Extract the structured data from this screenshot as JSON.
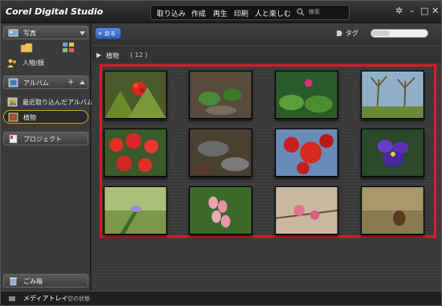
{
  "app": {
    "title": "Corel Digital Studio"
  },
  "menubar": {
    "items": [
      "取り込み",
      "作成",
      "再生",
      "印刷",
      "人と楽しむ"
    ],
    "search_placeholder": "検索"
  },
  "window_controls": {
    "settings": "✲",
    "minimize": "–",
    "maximize": "□",
    "close": "✕"
  },
  "sidebar": {
    "photos_label": "写真",
    "people_label": "人物/顔",
    "albums_label": "アルバム",
    "recent_albums_label": "最近取り込んだアルバム",
    "selected_album_label": "植物",
    "project_label": "プロジェクト",
    "trash_label": "ごみ箱"
  },
  "toolbar": {
    "back_label": "戻る",
    "tag_label": "タグ"
  },
  "breadcrumb": {
    "label": "植物",
    "count": "( 12 )"
  },
  "thumbnails": [
    {
      "name": "thumb-red-flower-buds"
    },
    {
      "name": "thumb-green-shoots"
    },
    {
      "name": "thumb-pink-flower-leaves"
    },
    {
      "name": "thumb-bare-trees"
    },
    {
      "name": "thumb-red-dahlias"
    },
    {
      "name": "thumb-garden-stones"
    },
    {
      "name": "thumb-red-berries-tree"
    },
    {
      "name": "thumb-purple-pansy"
    },
    {
      "name": "thumb-crocus-bud"
    },
    {
      "name": "thumb-pink-bell-flowers"
    },
    {
      "name": "thumb-pink-buds"
    },
    {
      "name": "thumb-pine-cone"
    }
  ],
  "bottom": {
    "label": "メディアトレイ",
    "status": "空の状態"
  },
  "colors": {
    "highlight": "#e0192a",
    "selected_border": "#d79a2a",
    "back_button": "#3f72c9"
  }
}
